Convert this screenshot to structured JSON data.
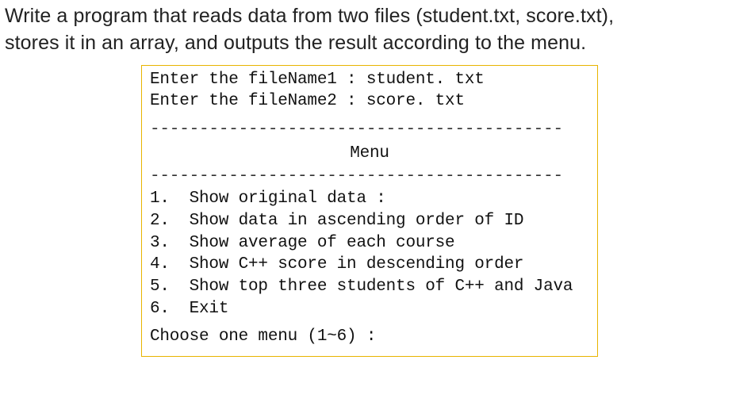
{
  "instruction": {
    "line1": "Write a program that reads data from two files (student.txt, score.txt),",
    "line2": "stores it in an array, and outputs the result according to the menu."
  },
  "console": {
    "prompt1": "Enter the fileName1 : student. txt",
    "prompt2": "Enter the fileName2 : score. txt",
    "rule": "------------------------------------------",
    "menu_title": "Menu",
    "items": {
      "i1": "1.  Show original data :",
      "i2": "2.  Show data in ascending order of ID",
      "i3": "3.  Show average of each course",
      "i4": "4.  Show C++ score in descending order",
      "i5": "5.  Show top three students of C++ and Java",
      "i6": "6.  Exit"
    },
    "choose": "Choose one menu (1~6) :"
  }
}
